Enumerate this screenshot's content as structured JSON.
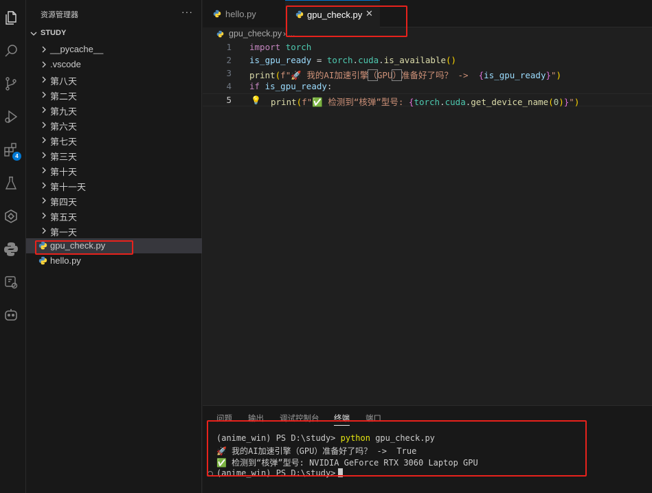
{
  "sidebar": {
    "title": "资源管理器",
    "more": "···",
    "section": "STUDY",
    "items": [
      {
        "label": "__pycache__"
      },
      {
        "label": ".vscode"
      },
      {
        "label": "第八天"
      },
      {
        "label": "第二天"
      },
      {
        "label": "第九天"
      },
      {
        "label": "第六天"
      },
      {
        "label": "第七天"
      },
      {
        "label": "第三天"
      },
      {
        "label": "第十天"
      },
      {
        "label": "第十一天"
      },
      {
        "label": "第四天"
      },
      {
        "label": "第五天"
      },
      {
        "label": "第一天"
      }
    ],
    "files": [
      {
        "label": "gpu_check.py"
      },
      {
        "label": "hello.py"
      }
    ]
  },
  "activity": {
    "extensions_badge": "4",
    "icons": [
      "files-icon",
      "search-icon",
      "source-control-icon",
      "run-debug-icon",
      "extensions-icon",
      "testing-icon",
      "remote-icon",
      "python-icon",
      "container-icon",
      "copilot-icon"
    ]
  },
  "tabs": [
    {
      "label": "hello.py"
    },
    {
      "label": "gpu_check.py",
      "close": "✕"
    }
  ],
  "breadcrumb": {
    "file": "gpu_check.py",
    "sep": "› ..."
  },
  "editor": {
    "line_numbers": [
      "1",
      "2",
      "3",
      "4",
      "5"
    ],
    "lines": {
      "l1_kw": "import",
      "l1_mod": "torch",
      "l2_var": "is_gpu_ready",
      "l2_op": " = ",
      "l2_mod": "torch",
      "l2_dot1": ".",
      "l2_var2": "cuda",
      "l2_dot2": ".",
      "l2_fn": "is_available",
      "l2_paren": "()",
      "l3_fn": "print",
      "l3_p1": "(",
      "l3_str1": "f\"🚀 我的AI加速引擎",
      "l3_hl1": "（",
      "l3_str2": "GPU",
      "l3_hl2": "）",
      "l3_str3": "准备好了吗？ -> ",
      "l3_b1": " {",
      "l3_var": "is_gpu_ready",
      "l3_b2": "}",
      "l3_str4": "\"",
      "l3_p2": ")",
      "l4_kw": "if",
      "l4_var": " is_gpu_ready",
      "l4_op": ":",
      "l5_fn": "print",
      "l5_p1": "(",
      "l5_str1": "f\"✅ 检测到“核弹”型号: ",
      "l5_b1": "{",
      "l5_mod": "torch",
      "l5_dot1": ".",
      "l5_var": "cuda",
      "l5_dot2": ".",
      "l5_fn2": "get_device_name",
      "l5_p3": "(",
      "l5_num": "0",
      "l5_p4": ")",
      "l5_b2": "}",
      "l5_str2": "\"",
      "l5_p2": ")"
    }
  },
  "panel": {
    "tabs": [
      "问题",
      "输出",
      "调试控制台",
      "终端",
      "端口"
    ],
    "terminal": {
      "line1_prompt": "(anime_win) PS D:\\study> ",
      "line1_cmd": "python",
      "line1_arg": " gpu_check.py",
      "line2": "🚀 我的AI加速引擎（GPU）准备好了吗？ ->  True",
      "line3": "✅ 检测到“核弹”型号: NVIDIA GeForce RTX 3060 Laptop GPU",
      "line4_prompt": "(anime_win) PS D:\\study>"
    }
  },
  "colors": {
    "accent": "#0078d4",
    "annotation": "#e8221c"
  }
}
